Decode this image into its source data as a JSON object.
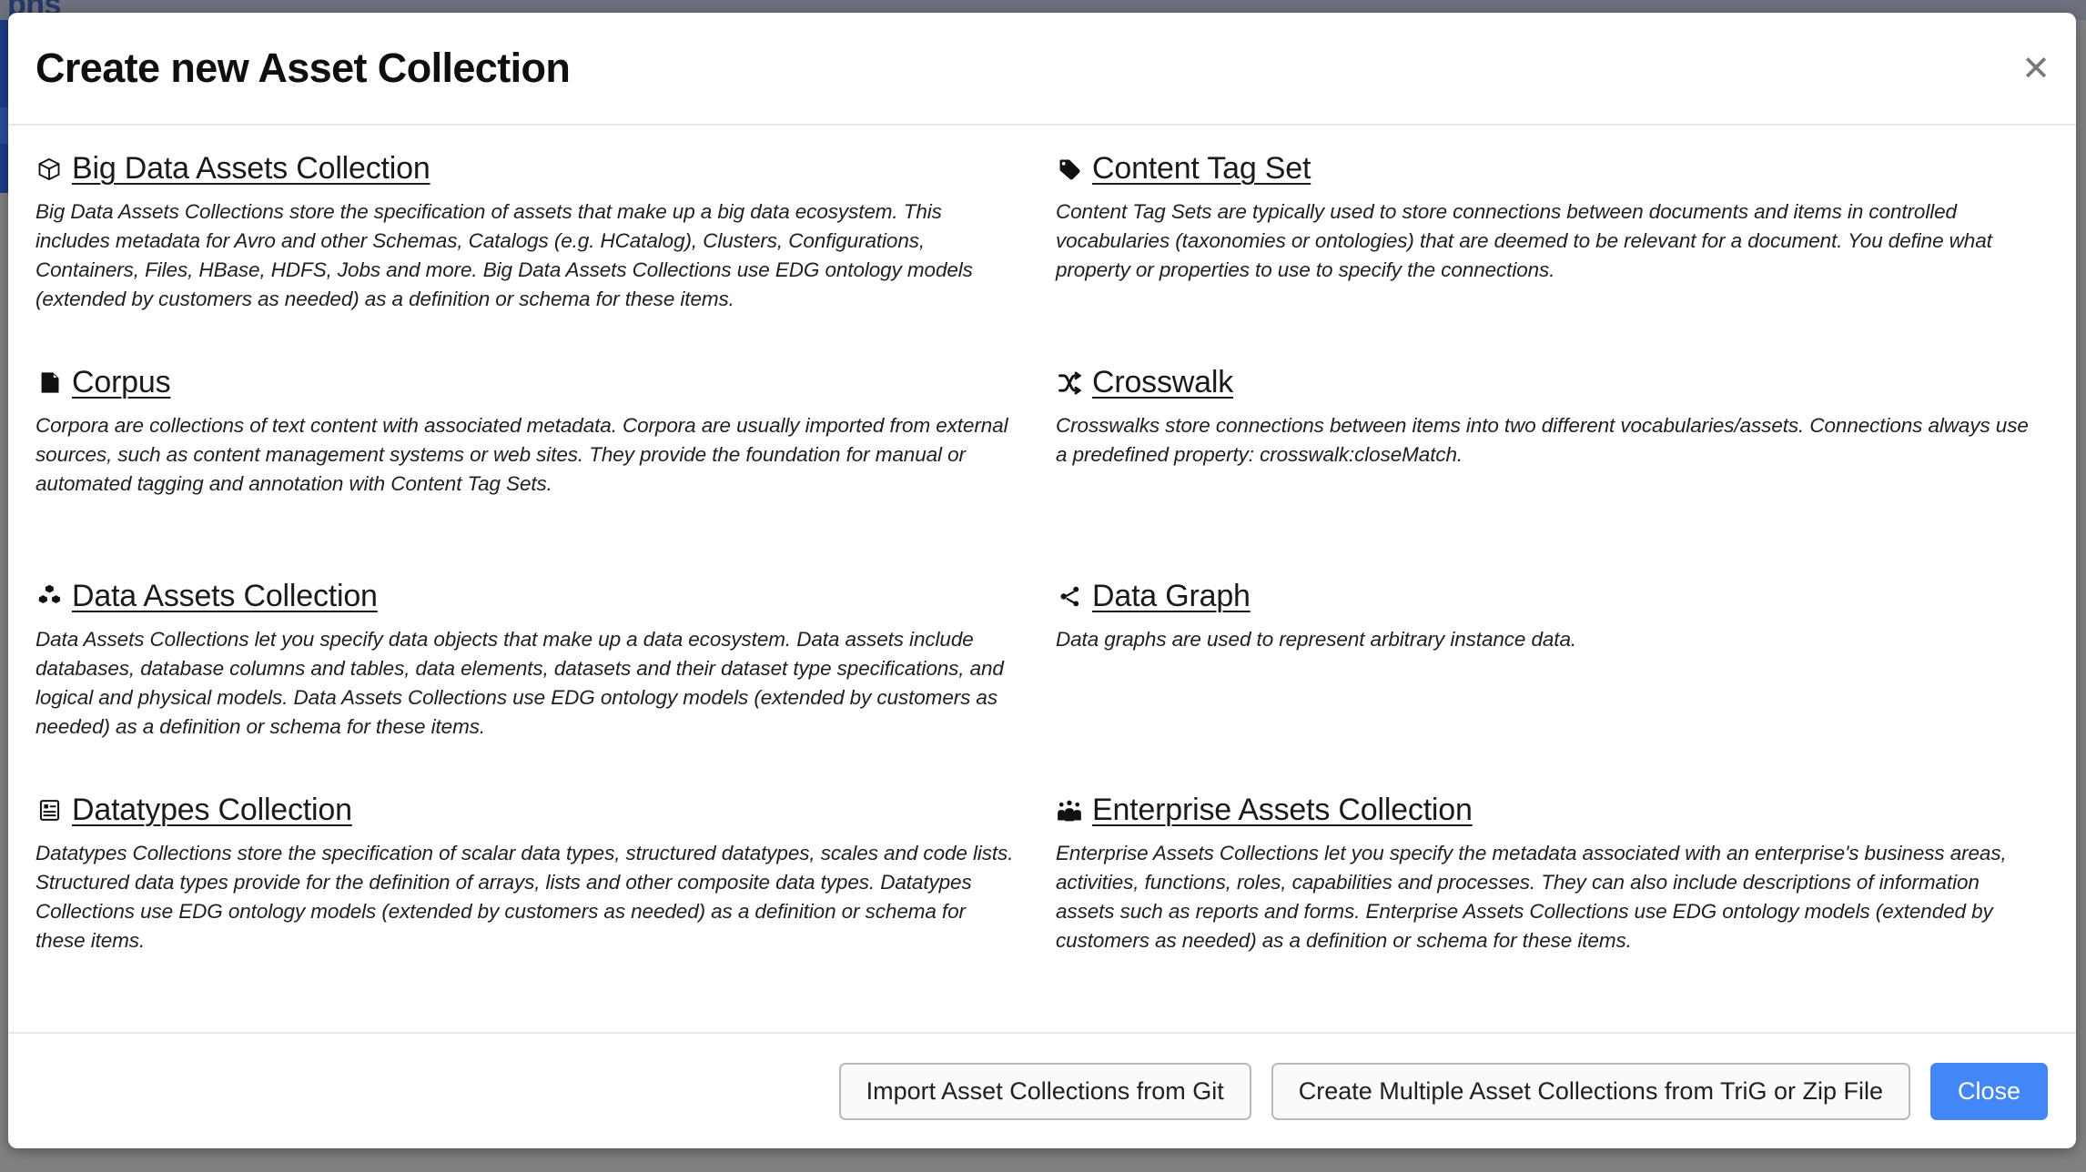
{
  "background": {
    "page_heading_fragment": "phs",
    "overlay_color": "#808083",
    "topbar_color": "#6e727e",
    "sidebar_color": "#1b3b86"
  },
  "modal": {
    "title": "Create new Asset Collection",
    "close_icon_label": "✕",
    "accent_color": "#4287f5"
  },
  "items": [
    {
      "icon": "cube-icon",
      "title": "Big Data Assets Collection",
      "description": "Big Data Assets Collections store the specification of assets that make up a big data ecosystem. This includes metadata for Avro and other Schemas, Catalogs (e.g. HCatalog), Clusters, Configurations, Containers, Files, HBase, HDFS, Jobs and more. Big Data Assets Collections use EDG ontology models (extended by customers as needed) as a definition or schema for these items."
    },
    {
      "icon": "tag-icon",
      "title": "Content Tag Set",
      "description": "Content Tag Sets are typically used to store connections between documents and items in controlled vocabularies (taxonomies or ontologies) that are deemed to be relevant for a document. You define what property or properties to use to specify the connections."
    },
    {
      "icon": "book-icon",
      "title": "Corpus",
      "description": "Corpora are collections of text content with associated metadata. Corpora are usually imported from external sources, such as content management systems or web sites. They provide the foundation for manual or automated tagging and annotation with Content Tag Sets."
    },
    {
      "icon": "shuffle-icon",
      "title": "Crosswalk",
      "description": "Crosswalks store connections between items into two different vocabularies/assets. Connections always use a predefined property: crosswalk:closeMatch."
    },
    {
      "icon": "cubes-icon",
      "title": "Data Assets Collection",
      "description": "Data Assets Collections let you specify data objects that make up a data ecosystem. Data assets include databases, database columns and tables, data elements, datasets and their dataset type specifications, and logical and physical models. Data Assets Collections use EDG ontology models (extended by customers as needed) as a definition or schema for these items."
    },
    {
      "icon": "share-nodes-icon",
      "title": "Data Graph",
      "description": "Data graphs are used to represent arbitrary instance data."
    },
    {
      "icon": "list-panel-icon",
      "title": "Datatypes Collection",
      "description": "Datatypes Collections store the specification of scalar data types, structured datatypes, scales and code lists. Structured data types provide for the definition of arrays, lists and other composite data types. Datatypes Collections use EDG ontology models (extended by customers as needed) as a definition or schema for these items."
    },
    {
      "icon": "users-group-icon",
      "title": "Enterprise Assets Collection",
      "description": "Enterprise Assets Collections let you specify the metadata associated with an enterprise's business areas, activities, functions, roles, capabilities and processes. They can also include descriptions of information assets such as reports and forms. Enterprise Assets Collections use EDG ontology models (extended by customers as needed) as a definition or schema for these items."
    }
  ],
  "footer": {
    "import_git_label": "Import Asset Collections from Git",
    "create_multiple_label": "Create Multiple Asset Collections from TriG or Zip File",
    "close_label": "Close"
  }
}
